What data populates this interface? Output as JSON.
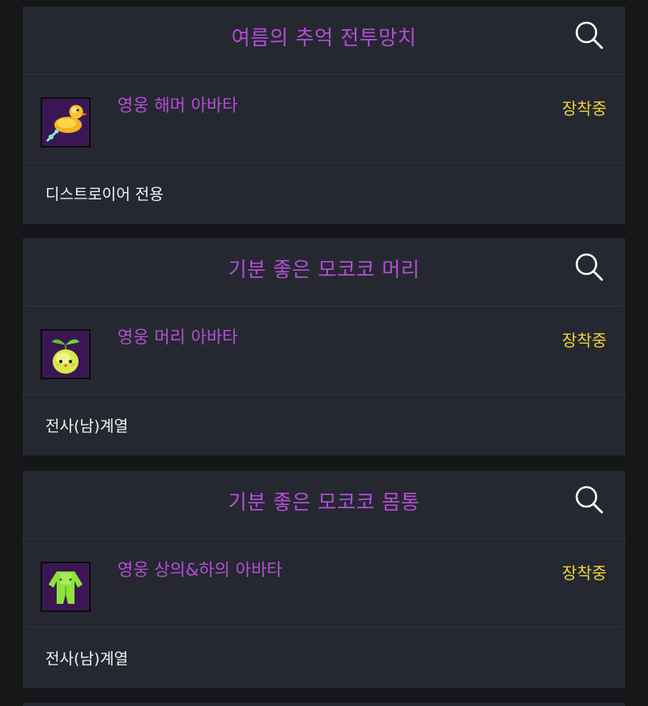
{
  "colors": {
    "page_background": "#141618",
    "card_background": "#252830",
    "title_color": "#b24fd6",
    "item_name_color": "#b24fd6",
    "status_color": "#f1d230",
    "class_text_color": "#f2f2f2",
    "thumbnail_background": "#3a1752"
  },
  "cards": [
    {
      "title": "여름의 추억 전투망치",
      "search_icon": "search-icon",
      "item": {
        "thumbnail_icon": "rubber-duck-hammer-icon",
        "name": "영웅 해머 아바타",
        "status": "장착중"
      },
      "class_restriction": "디스트로이어 전용"
    },
    {
      "title": "기분 좋은 모코코 머리",
      "search_icon": "search-icon",
      "item": {
        "thumbnail_icon": "mokoko-head-icon",
        "name": "영웅 머리 아바타",
        "status": "장착중"
      },
      "class_restriction": "전사(남)계열"
    },
    {
      "title": "기분 좋은 모코코 몸통",
      "search_icon": "search-icon",
      "item": {
        "thumbnail_icon": "mokoko-body-icon",
        "name": "영웅 상의&하의 아바타",
        "status": "장착중"
      },
      "class_restriction": "전사(남)계열"
    }
  ]
}
